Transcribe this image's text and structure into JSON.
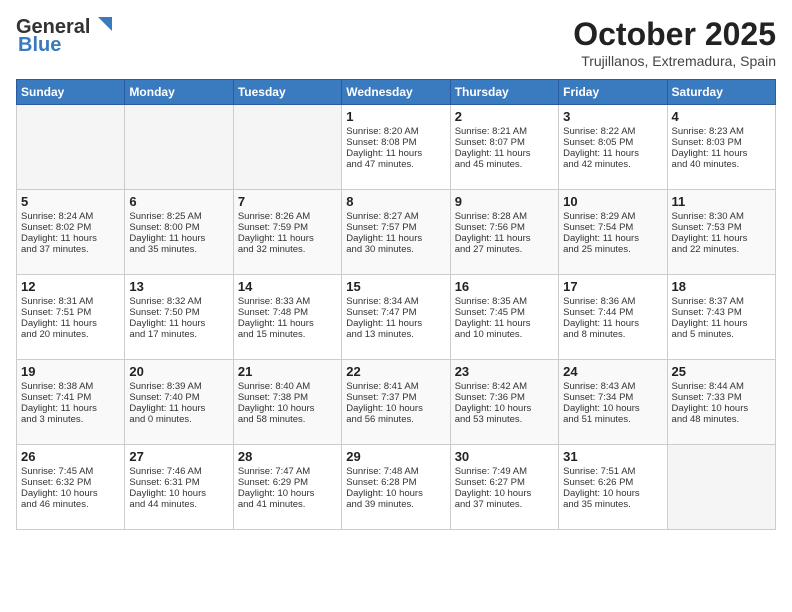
{
  "header": {
    "logo_general": "General",
    "logo_blue": "Blue",
    "month_title": "October 2025",
    "location": "Trujillanos, Extremadura, Spain"
  },
  "weekdays": [
    "Sunday",
    "Monday",
    "Tuesday",
    "Wednesday",
    "Thursday",
    "Friday",
    "Saturday"
  ],
  "weeks": [
    [
      {
        "day": "",
        "info": ""
      },
      {
        "day": "",
        "info": ""
      },
      {
        "day": "",
        "info": ""
      },
      {
        "day": "1",
        "info": "Sunrise: 8:20 AM\nSunset: 8:08 PM\nDaylight: 11 hours\nand 47 minutes."
      },
      {
        "day": "2",
        "info": "Sunrise: 8:21 AM\nSunset: 8:07 PM\nDaylight: 11 hours\nand 45 minutes."
      },
      {
        "day": "3",
        "info": "Sunrise: 8:22 AM\nSunset: 8:05 PM\nDaylight: 11 hours\nand 42 minutes."
      },
      {
        "day": "4",
        "info": "Sunrise: 8:23 AM\nSunset: 8:03 PM\nDaylight: 11 hours\nand 40 minutes."
      }
    ],
    [
      {
        "day": "5",
        "info": "Sunrise: 8:24 AM\nSunset: 8:02 PM\nDaylight: 11 hours\nand 37 minutes."
      },
      {
        "day": "6",
        "info": "Sunrise: 8:25 AM\nSunset: 8:00 PM\nDaylight: 11 hours\nand 35 minutes."
      },
      {
        "day": "7",
        "info": "Sunrise: 8:26 AM\nSunset: 7:59 PM\nDaylight: 11 hours\nand 32 minutes."
      },
      {
        "day": "8",
        "info": "Sunrise: 8:27 AM\nSunset: 7:57 PM\nDaylight: 11 hours\nand 30 minutes."
      },
      {
        "day": "9",
        "info": "Sunrise: 8:28 AM\nSunset: 7:56 PM\nDaylight: 11 hours\nand 27 minutes."
      },
      {
        "day": "10",
        "info": "Sunrise: 8:29 AM\nSunset: 7:54 PM\nDaylight: 11 hours\nand 25 minutes."
      },
      {
        "day": "11",
        "info": "Sunrise: 8:30 AM\nSunset: 7:53 PM\nDaylight: 11 hours\nand 22 minutes."
      }
    ],
    [
      {
        "day": "12",
        "info": "Sunrise: 8:31 AM\nSunset: 7:51 PM\nDaylight: 11 hours\nand 20 minutes."
      },
      {
        "day": "13",
        "info": "Sunrise: 8:32 AM\nSunset: 7:50 PM\nDaylight: 11 hours\nand 17 minutes."
      },
      {
        "day": "14",
        "info": "Sunrise: 8:33 AM\nSunset: 7:48 PM\nDaylight: 11 hours\nand 15 minutes."
      },
      {
        "day": "15",
        "info": "Sunrise: 8:34 AM\nSunset: 7:47 PM\nDaylight: 11 hours\nand 13 minutes."
      },
      {
        "day": "16",
        "info": "Sunrise: 8:35 AM\nSunset: 7:45 PM\nDaylight: 11 hours\nand 10 minutes."
      },
      {
        "day": "17",
        "info": "Sunrise: 8:36 AM\nSunset: 7:44 PM\nDaylight: 11 hours\nand 8 minutes."
      },
      {
        "day": "18",
        "info": "Sunrise: 8:37 AM\nSunset: 7:43 PM\nDaylight: 11 hours\nand 5 minutes."
      }
    ],
    [
      {
        "day": "19",
        "info": "Sunrise: 8:38 AM\nSunset: 7:41 PM\nDaylight: 11 hours\nand 3 minutes."
      },
      {
        "day": "20",
        "info": "Sunrise: 8:39 AM\nSunset: 7:40 PM\nDaylight: 11 hours\nand 0 minutes."
      },
      {
        "day": "21",
        "info": "Sunrise: 8:40 AM\nSunset: 7:38 PM\nDaylight: 10 hours\nand 58 minutes."
      },
      {
        "day": "22",
        "info": "Sunrise: 8:41 AM\nSunset: 7:37 PM\nDaylight: 10 hours\nand 56 minutes."
      },
      {
        "day": "23",
        "info": "Sunrise: 8:42 AM\nSunset: 7:36 PM\nDaylight: 10 hours\nand 53 minutes."
      },
      {
        "day": "24",
        "info": "Sunrise: 8:43 AM\nSunset: 7:34 PM\nDaylight: 10 hours\nand 51 minutes."
      },
      {
        "day": "25",
        "info": "Sunrise: 8:44 AM\nSunset: 7:33 PM\nDaylight: 10 hours\nand 48 minutes."
      }
    ],
    [
      {
        "day": "26",
        "info": "Sunrise: 7:45 AM\nSunset: 6:32 PM\nDaylight: 10 hours\nand 46 minutes."
      },
      {
        "day": "27",
        "info": "Sunrise: 7:46 AM\nSunset: 6:31 PM\nDaylight: 10 hours\nand 44 minutes."
      },
      {
        "day": "28",
        "info": "Sunrise: 7:47 AM\nSunset: 6:29 PM\nDaylight: 10 hours\nand 41 minutes."
      },
      {
        "day": "29",
        "info": "Sunrise: 7:48 AM\nSunset: 6:28 PM\nDaylight: 10 hours\nand 39 minutes."
      },
      {
        "day": "30",
        "info": "Sunrise: 7:49 AM\nSunset: 6:27 PM\nDaylight: 10 hours\nand 37 minutes."
      },
      {
        "day": "31",
        "info": "Sunrise: 7:51 AM\nSunset: 6:26 PM\nDaylight: 10 hours\nand 35 minutes."
      },
      {
        "day": "",
        "info": ""
      }
    ]
  ]
}
